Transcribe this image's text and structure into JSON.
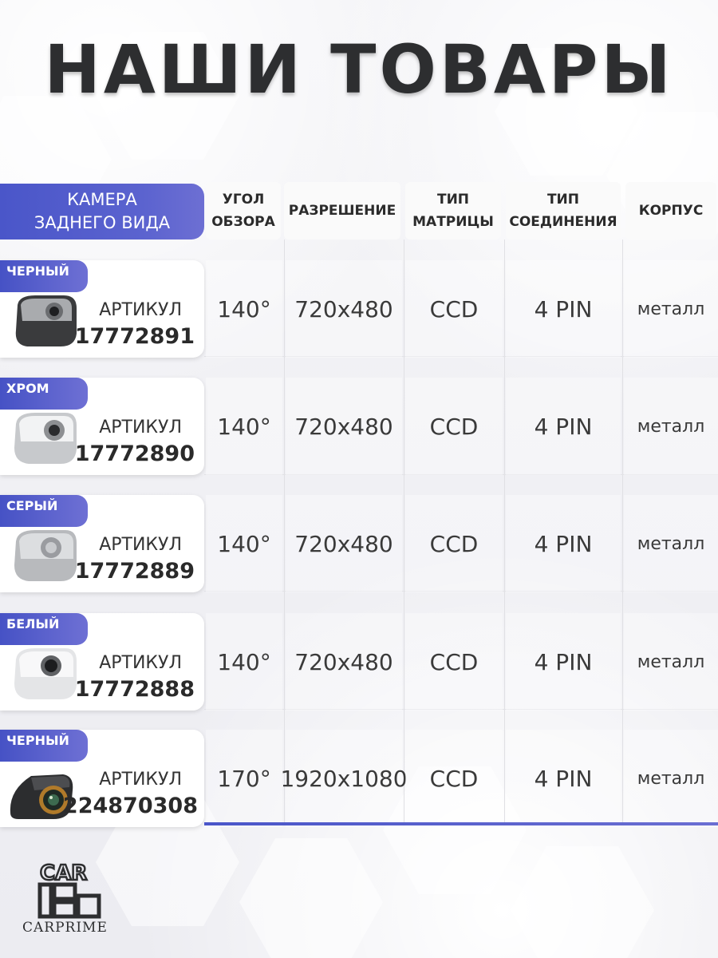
{
  "title": "НАШИ ТОВАРЫ",
  "header": {
    "label_line1": "КАМЕРА",
    "label_line2": "ЗАДНЕГО ВИДА",
    "col_angle_1": "УГОЛ",
    "col_angle_2": "ОБЗОРА",
    "col_resolution": "РАЗРЕШЕНИЕ",
    "col_matrix_1": "ТИП",
    "col_matrix_2": "МАТРИЦЫ",
    "col_connection_1": "ТИП",
    "col_connection_2": "СОЕДИНЕНИЯ",
    "col_body": "КОРПУС"
  },
  "products": [
    {
      "color": "ЧЕРНЫЙ",
      "article_label": "АРТИКУЛ",
      "article": "17772891",
      "angle": "140°",
      "resolution": "720x480",
      "matrix": "CCD",
      "connection": "4 PIN",
      "body": "металл",
      "finish": "black"
    },
    {
      "color": "ХРОМ",
      "article_label": "АРТИКУЛ",
      "article": "17772890",
      "angle": "140°",
      "resolution": "720x480",
      "matrix": "CCD",
      "connection": "4 PIN",
      "body": "металл",
      "finish": "chrome"
    },
    {
      "color": "СЕРЫЙ",
      "article_label": "АРТИКУЛ",
      "article": "17772889",
      "angle": "140°",
      "resolution": "720x480",
      "matrix": "CCD",
      "connection": "4 PIN",
      "body": "металл",
      "finish": "gray"
    },
    {
      "color": "БЕЛЫЙ",
      "article_label": "АРТИКУЛ",
      "article": "17772888",
      "angle": "140°",
      "resolution": "720x480",
      "matrix": "CCD",
      "connection": "4 PIN",
      "body": "металл",
      "finish": "white"
    },
    {
      "color": "ЧЕРНЫЙ",
      "article_label": "АРТИКУЛ",
      "article": "224870308",
      "angle": "170°",
      "resolution": "1920x1080",
      "matrix": "CCD",
      "connection": "4 PIN",
      "body": "металл",
      "finish": "black-hd"
    }
  ],
  "brand": {
    "name": "CARPRIME",
    "logo_text": "CAR PRIME"
  },
  "colors": {
    "accent": "#4a56c9",
    "accent_light": "#6d6fd3",
    "title": "#2d2e30"
  }
}
